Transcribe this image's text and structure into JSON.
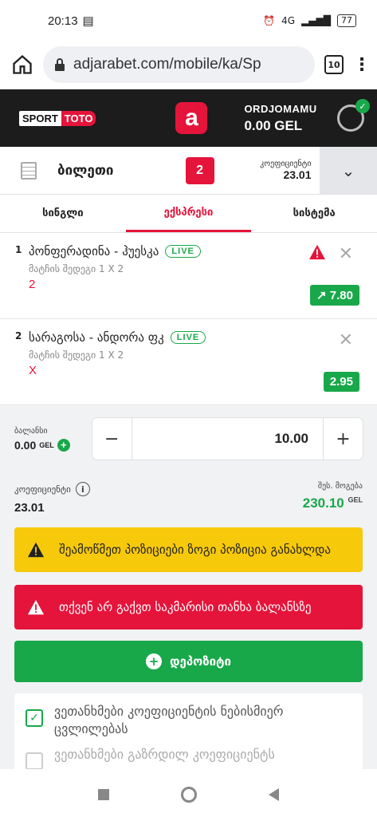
{
  "statusbar": {
    "time": "20:13",
    "network": "4G",
    "battery": "77"
  },
  "browser": {
    "url": "adjarabet.com/mobile/ka/Sp",
    "tab_count": "10"
  },
  "header": {
    "logo_left": "SPORT",
    "logo_right": "TOTO",
    "username": "ORDJOMAMU",
    "balance": "0.00 GEL"
  },
  "ticket": {
    "label": "ბილეთი",
    "count": "2",
    "coef_label": "კოეფიციენტი",
    "coef_value": "23.01"
  },
  "bet_tabs": [
    {
      "label": "სინგლი",
      "active": false
    },
    {
      "label": "ექსპრესი",
      "active": true
    },
    {
      "label": "სისტემა",
      "active": false
    }
  ],
  "selections": [
    {
      "num": "1",
      "title": "პონფერადინა - ჰუესკა",
      "live": "LIVE",
      "market": "მატჩის შედეგი 1 X 2",
      "pick": "2",
      "odds": "7.80",
      "warning": true
    },
    {
      "num": "2",
      "title": "სარაგოსა - ანდორა ფკ",
      "live": "LIVE",
      "market": "მატჩის შედეგი 1 X 2",
      "pick": "X",
      "odds": "2.95",
      "warning": false
    }
  ],
  "stake": {
    "balance_label": "ბალანსი",
    "balance_value": "0.00",
    "currency": "GEL",
    "amount": "10.00"
  },
  "summary": {
    "coef_label": "კოეფიციენტი",
    "coef_value": "23.01",
    "win_label": "შეს. მოგება",
    "win_value": "230.10",
    "currency": "GEL"
  },
  "alerts": {
    "yellow": "შეამოწმეთ პოზიციები ზოგი პოზიცია განახლდა",
    "red": "თქვენ არ გაქვთ საკმარისი თანხა ბალანსზე"
  },
  "deposit_label": "დეპოზიტი",
  "agreements": {
    "first": "ვეთანხმები კოეფიციენტის ნებისმიერ ცვლილებას",
    "second": "ვეთანხმები გაზრდილ კოეფიციენტს"
  },
  "colors": {
    "brand_red": "#e5143b",
    "green": "#18a84a",
    "warning_yellow": "#f7c90b",
    "dark_header": "#1c1c1c"
  }
}
